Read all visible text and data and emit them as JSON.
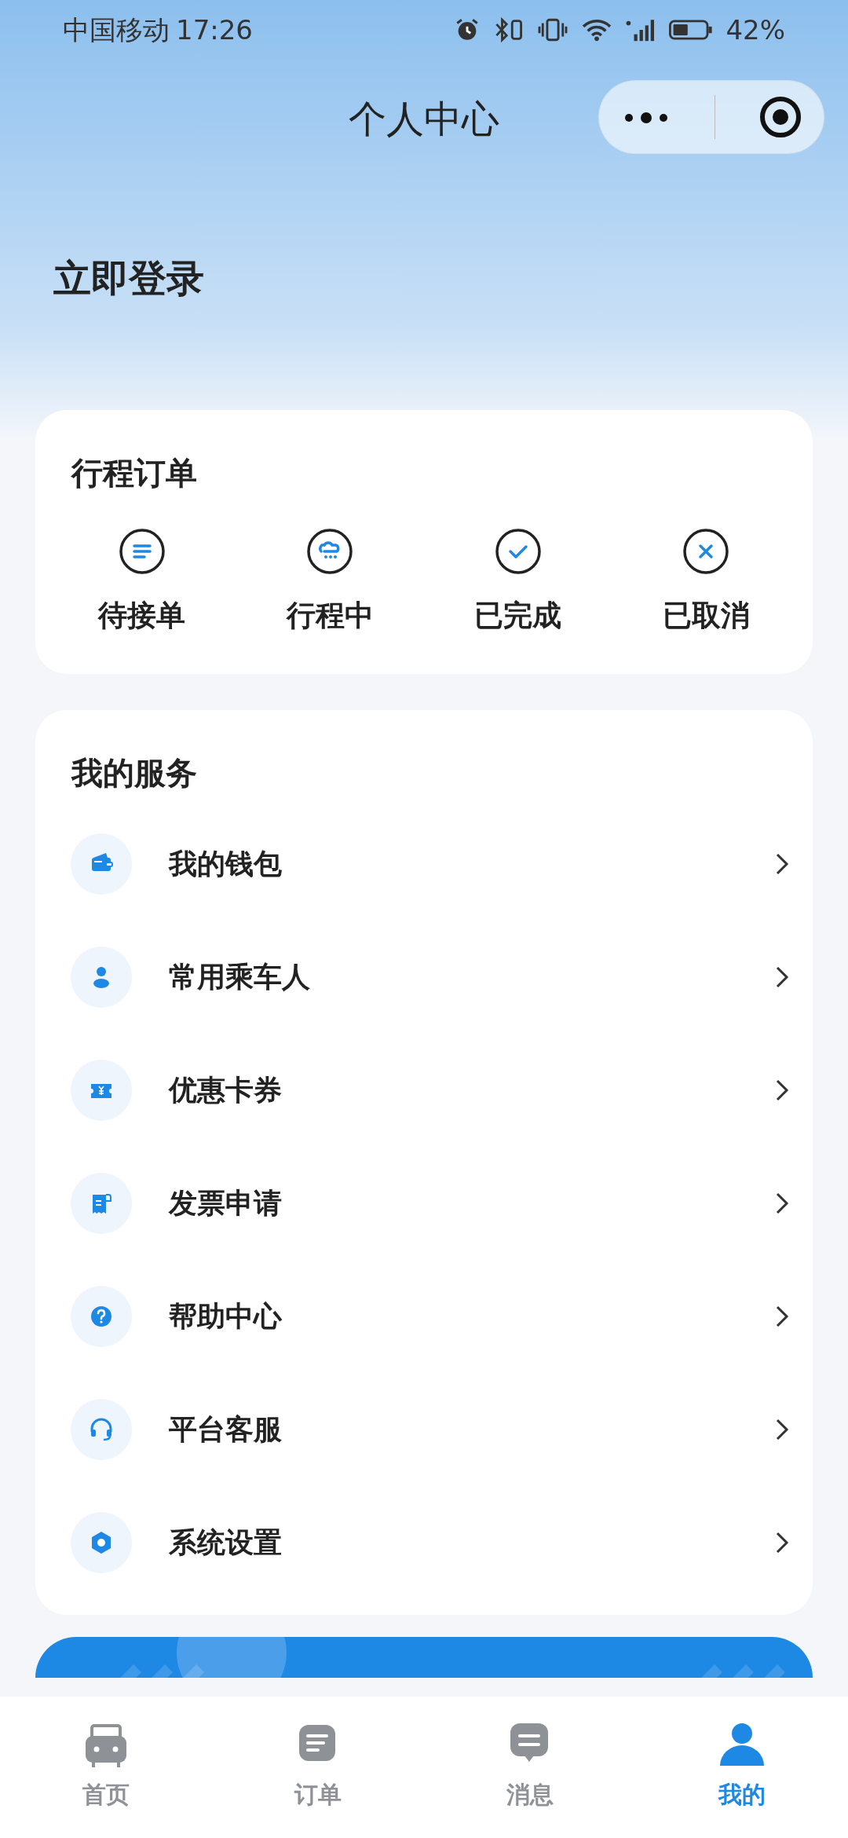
{
  "status_bar": {
    "carrier": "中国移动",
    "time": "17:26",
    "battery": "42%"
  },
  "nav": {
    "title": "个人中心"
  },
  "login": {
    "label": "立即登录"
  },
  "orders": {
    "title": "行程订单",
    "items": [
      {
        "label": "待接单",
        "kind": "pending"
      },
      {
        "label": "行程中",
        "kind": "ongoing"
      },
      {
        "label": "已完成",
        "kind": "done"
      },
      {
        "label": "已取消",
        "kind": "cancelled"
      }
    ]
  },
  "services": {
    "title": "我的服务",
    "items": [
      {
        "label": "我的钱包",
        "kind": "wallet"
      },
      {
        "label": "常用乘车人",
        "kind": "person"
      },
      {
        "label": "优惠卡券",
        "kind": "coupon"
      },
      {
        "label": "发票申请",
        "kind": "invoice"
      },
      {
        "label": "帮助中心",
        "kind": "help"
      },
      {
        "label": "平台客服",
        "kind": "headset"
      },
      {
        "label": "系统设置",
        "kind": "settings"
      }
    ]
  },
  "tab_bar": [
    {
      "label": "首页",
      "kind": "car",
      "selected": false
    },
    {
      "label": "订单",
      "kind": "list",
      "selected": false
    },
    {
      "label": "消息",
      "kind": "message",
      "selected": false
    },
    {
      "label": "我的",
      "kind": "user",
      "selected": true
    }
  ]
}
